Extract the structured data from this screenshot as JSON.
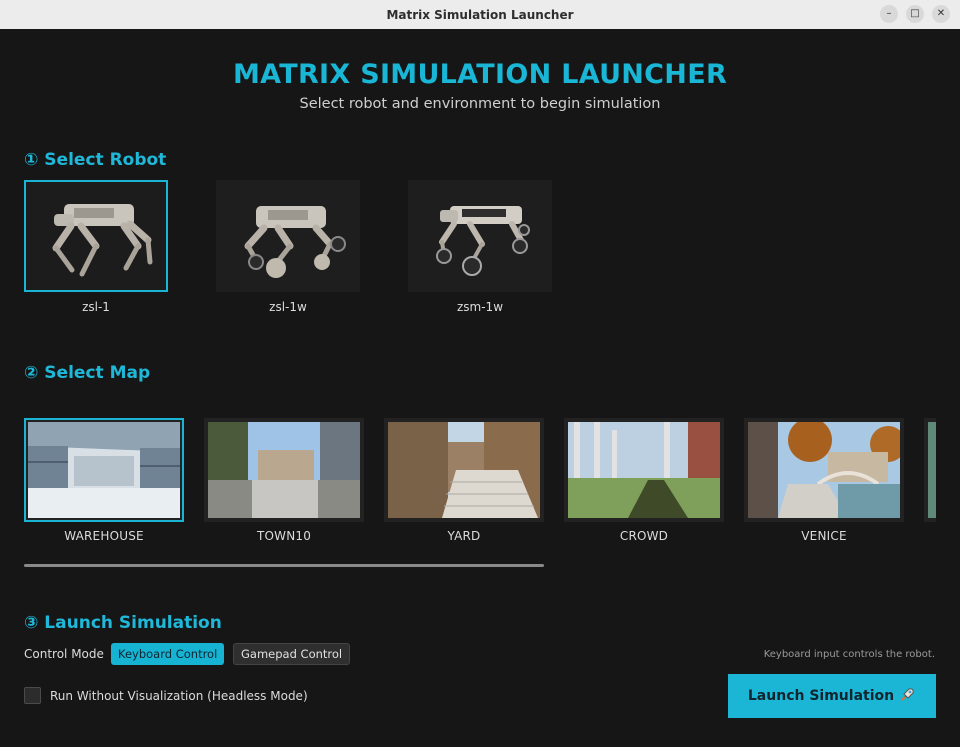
{
  "window": {
    "title": "Matrix Simulation Launcher"
  },
  "header": {
    "title": "MATRIX SIMULATION LAUNCHER",
    "subtitle": "Select robot and environment to begin simulation"
  },
  "robot_section": {
    "title": "① Select Robot",
    "robots": [
      {
        "name": "zsl-1",
        "selected": true
      },
      {
        "name": "zsl-1w",
        "selected": false
      },
      {
        "name": "zsm-1w",
        "selected": false
      }
    ]
  },
  "map_section": {
    "title": "② Select Map",
    "maps": [
      {
        "name": "WAREHOUSE",
        "selected": true
      },
      {
        "name": "TOWN10",
        "selected": false
      },
      {
        "name": "YARD",
        "selected": false
      },
      {
        "name": "CROWD",
        "selected": false
      },
      {
        "name": "VENICE",
        "selected": false
      }
    ]
  },
  "launch_section": {
    "title": "③ Launch Simulation",
    "control_mode_label": "Control Mode",
    "keyboard_label": "Keyboard Control",
    "gamepad_label": "Gamepad Control",
    "active_mode": "Keyboard Control",
    "hint": "Keyboard input controls the robot.",
    "headless_label": "Run Without Visualization (Headless Mode)",
    "headless_checked": false,
    "launch_label": "Launch Simulation",
    "launch_icon": "rocket-icon"
  },
  "colors": {
    "accent": "#1ab4d4",
    "background": "#161616"
  }
}
